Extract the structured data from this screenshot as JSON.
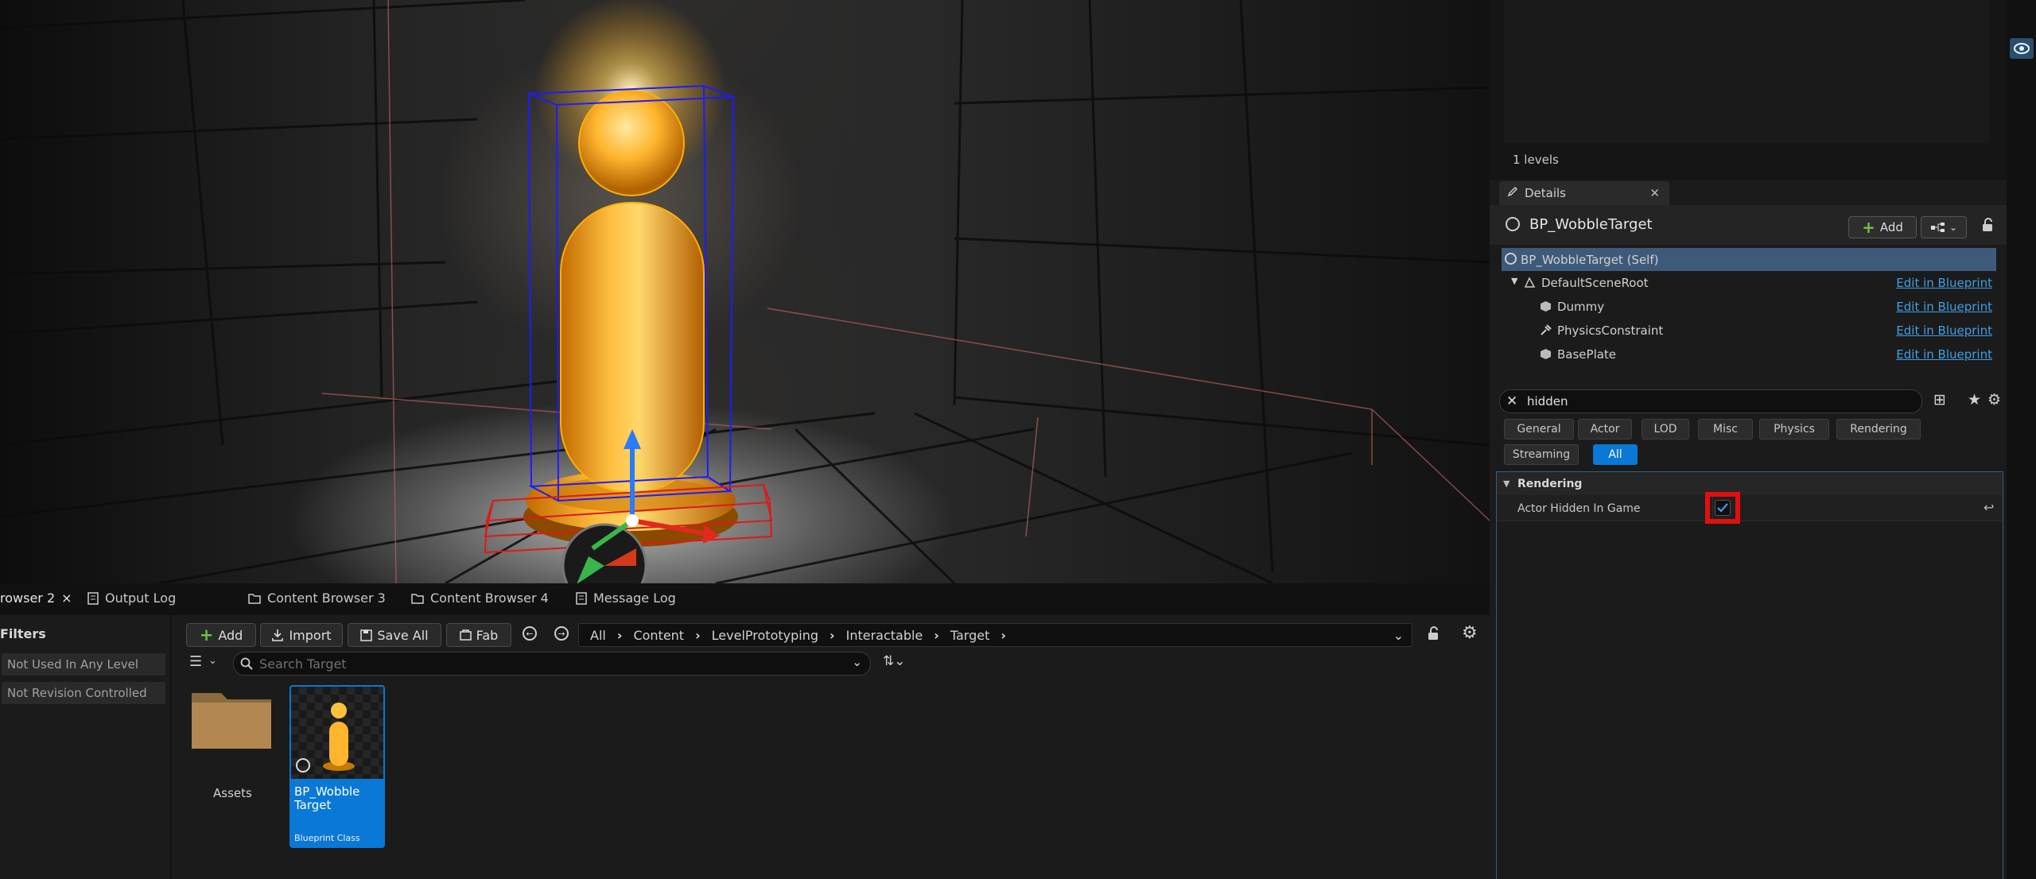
{
  "outliner": {
    "levels_count": "1 levels"
  },
  "details": {
    "tab_label": "Details",
    "actor_name": "BP_WobbleTarget",
    "add_label": "Add",
    "components": [
      {
        "name": "BP_WobbleTarget (Self)",
        "edit": ""
      },
      {
        "name": "DefaultSceneRoot",
        "edit": "Edit in Blueprint"
      },
      {
        "name": "Dummy",
        "edit": "Edit in Blueprint"
      },
      {
        "name": "PhysicsConstraint",
        "edit": "Edit in Blueprint"
      },
      {
        "name": "BasePlate",
        "edit": "Edit in Blueprint"
      }
    ],
    "search_value": "hidden",
    "filters": [
      "General",
      "Actor",
      "LOD",
      "Misc",
      "Physics",
      "Rendering",
      "Streaming",
      "All"
    ],
    "active_filter": "All",
    "category": "Rendering",
    "property": {
      "label": "Actor Hidden In Game",
      "checked": true
    }
  },
  "bottom_tabs": [
    {
      "label": "rowser 2",
      "close": "×",
      "active": true
    },
    {
      "label": "Output Log",
      "close": "",
      "active": false
    },
    {
      "label": "Content Browser 3",
      "close": "",
      "active": false
    },
    {
      "label": "Content Browser 4",
      "close": "",
      "active": false
    },
    {
      "label": "Message Log",
      "close": "",
      "active": false
    }
  ],
  "content_browser": {
    "filters_title": "Filters",
    "filter_items": [
      "Not Used In Any Level",
      "Not Revision Controlled"
    ],
    "toolbar": {
      "add": "Add",
      "import": "Import",
      "save_all": "Save All",
      "fab": "Fab"
    },
    "path": [
      "All",
      "Content",
      "LevelPrototyping",
      "Interactable",
      "Target"
    ],
    "search_placeholder": "Search Target",
    "assets": [
      {
        "name": "Assets",
        "type": "folder"
      },
      {
        "name": "BP_Wobble Target",
        "class": "Blueprint Class",
        "type": "blueprint"
      }
    ]
  },
  "colors": {
    "accent": "#0a78d6",
    "highlight": "#e01010",
    "link": "#3f9fe6",
    "selected_row": "#3d5a7a",
    "add_plus": "#6cc24a"
  }
}
